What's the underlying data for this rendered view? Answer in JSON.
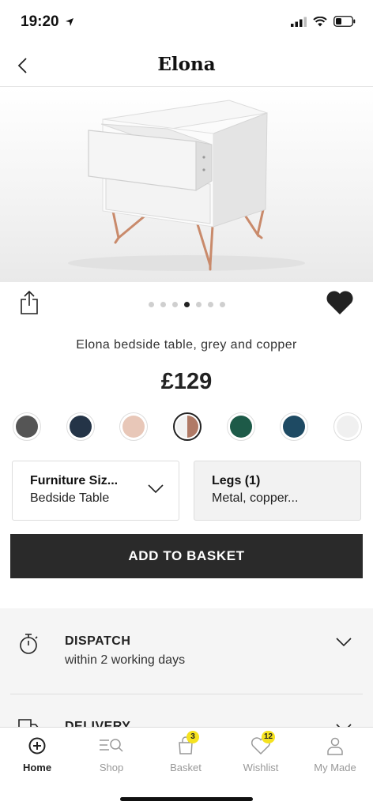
{
  "status_bar": {
    "time": "19:20"
  },
  "nav": {
    "title": "Elona"
  },
  "gallery": {
    "dot_count": 7,
    "active_index": 3
  },
  "product": {
    "name": "Elona bedside table, grey and copper",
    "price": "£129"
  },
  "swatches": [
    {
      "color": "#555555",
      "selected": false
    },
    {
      "color": "#243447",
      "selected": false
    },
    {
      "color": "#e8c7b8",
      "selected": false
    },
    {
      "color": "split",
      "selected": true
    },
    {
      "color": "#1d5a48",
      "selected": false
    },
    {
      "color": "#1e4a63",
      "selected": false
    },
    {
      "color": "#f0f0f0",
      "selected": false
    }
  ],
  "options": {
    "size": {
      "label": "Furniture Siz...",
      "value": "Bedside Table"
    },
    "legs": {
      "label": "Legs (1)",
      "value": "Metal, copper..."
    }
  },
  "cta": {
    "add_to_basket": "ADD TO BASKET"
  },
  "info": {
    "dispatch_title": "DISPATCH",
    "dispatch_sub": "within 2 working days",
    "delivery_title": "DELIVERY"
  },
  "tabs": [
    {
      "label": "Home",
      "icon": "home-plus-icon",
      "active": true,
      "badge": ""
    },
    {
      "label": "Shop",
      "icon": "shop-search-icon",
      "active": false,
      "badge": ""
    },
    {
      "label": "Basket",
      "icon": "basket-icon",
      "active": false,
      "badge": "3"
    },
    {
      "label": "Wishlist",
      "icon": "heart-icon",
      "active": false,
      "badge": "12"
    },
    {
      "label": "My Made",
      "icon": "user-icon",
      "active": false,
      "badge": ""
    }
  ],
  "colors": {
    "accent_dark": "#2a2a2a",
    "badge": "#f5e21f",
    "copper": "#c98a6b"
  }
}
